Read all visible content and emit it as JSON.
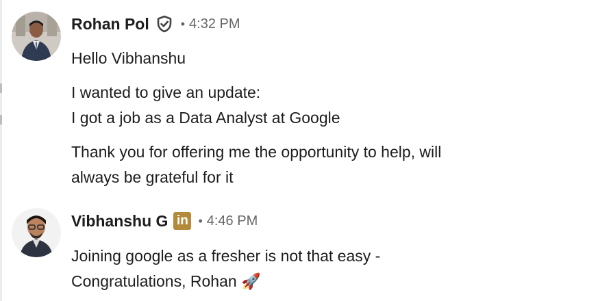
{
  "messages": [
    {
      "sender": "Rohan Pol",
      "badge_icon": "verified-shield-icon",
      "separator": "•",
      "time": "4:32 PM",
      "paragraphs": [
        [
          "Hello Vibhanshu"
        ],
        [
          "I wanted to give an update:",
          "I got a job as a Data Analyst at Google"
        ],
        [
          "Thank you for offering me the opportunity to help, will",
          "always be grateful for it"
        ]
      ]
    },
    {
      "sender": "Vibhanshu G",
      "badge_icon": "linkedin-icon",
      "badge_text": "in",
      "separator": "•",
      "time": "4:46 PM",
      "paragraphs": [
        [
          "Joining google as a fresher is not that easy -",
          "Congratulations, Rohan 🚀"
        ]
      ]
    }
  ],
  "colors": {
    "text": "#1d1d1d",
    "meta": "#666666",
    "linkedin_badge": "#b3893a",
    "background": "#ffffff"
  }
}
